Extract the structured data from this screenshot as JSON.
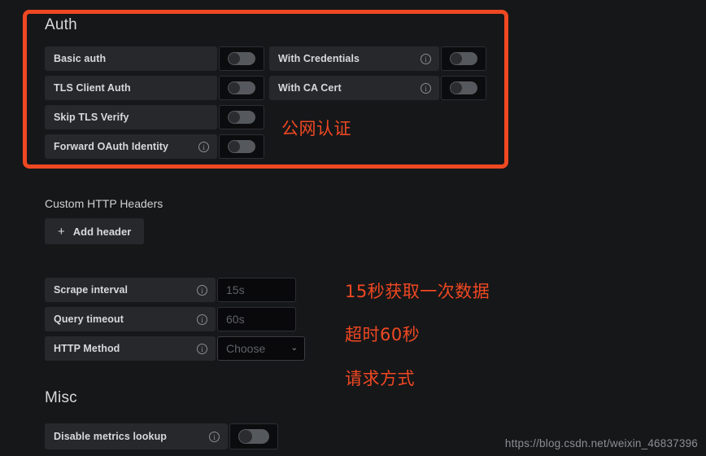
{
  "sections": {
    "auth": {
      "title": "Auth",
      "rows": [
        {
          "label": "Basic auth",
          "has_info": false,
          "control": "toggle",
          "state": "off"
        },
        {
          "label": "TLS Client Auth",
          "has_info": false,
          "control": "toggle",
          "state": "off"
        },
        {
          "label": "Skip TLS Verify",
          "has_info": false,
          "control": "toggle",
          "state": "off"
        },
        {
          "label": "Forward OAuth Identity",
          "has_info": true,
          "control": "toggle",
          "state": "off"
        }
      ],
      "right_rows": [
        {
          "label": "With Credentials",
          "has_info": true,
          "control": "toggle",
          "state": "off"
        },
        {
          "label": "With CA Cert",
          "has_info": true,
          "control": "toggle",
          "state": "off"
        }
      ]
    },
    "custom_headers": {
      "title": "Custom HTTP Headers",
      "add_button_label": "Add header",
      "add_button_icon": "plus-icon"
    },
    "settings": {
      "rows": [
        {
          "label": "Scrape interval",
          "has_info": true,
          "control": "text",
          "value": "15s",
          "placeholder": "15s"
        },
        {
          "label": "Query timeout",
          "has_info": true,
          "control": "text",
          "value": "60s",
          "placeholder": "60s"
        },
        {
          "label": "HTTP Method",
          "has_info": true,
          "control": "select",
          "value": "Choose",
          "icon": "chevron-down-icon"
        }
      ]
    },
    "misc": {
      "title": "Misc",
      "rows": [
        {
          "label": "Disable metrics lookup",
          "has_info": true,
          "control": "toggle",
          "state": "off"
        }
      ]
    }
  },
  "annotations": {
    "box_color": "#ef4822",
    "notes": [
      {
        "text": "公网认证"
      },
      {
        "text": "15秒获取一次数据"
      },
      {
        "text": "超时60秒"
      },
      {
        "text": "请求方式"
      }
    ]
  },
  "watermark": {
    "text": "https://blog.csdn.net/weixin_46837396"
  },
  "icons": {
    "info": "i",
    "chevron_down": "⌄",
    "plus": "+"
  }
}
